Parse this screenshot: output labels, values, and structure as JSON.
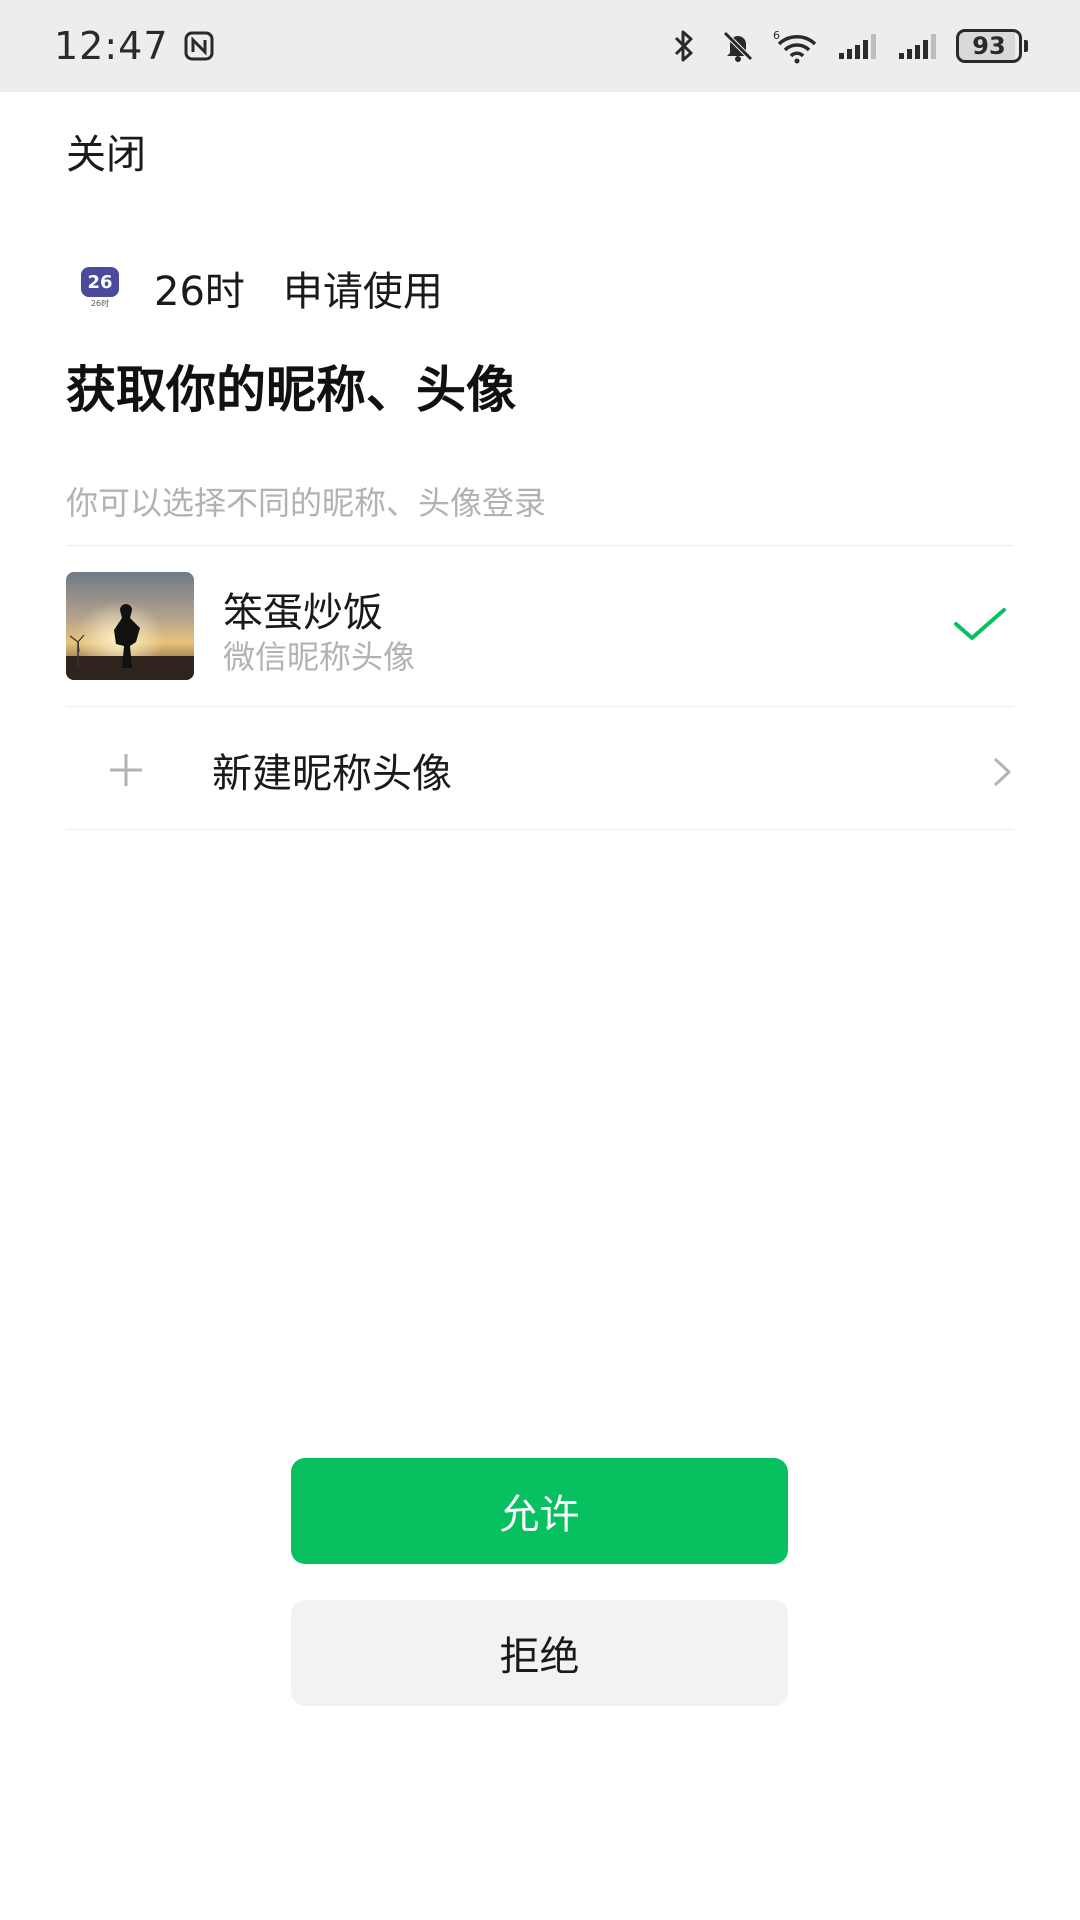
{
  "status_bar": {
    "time": "12:47",
    "battery": "93",
    "icons": [
      "nfc-icon",
      "bluetooth-icon",
      "mute-bell-icon",
      "wifi-icon",
      "signal-icon",
      "signal-icon",
      "battery-icon"
    ]
  },
  "header": {
    "close_label": "关闭"
  },
  "app": {
    "name": "26时",
    "logo_text": "26",
    "logo_caption": "26时",
    "request_text": "申请使用"
  },
  "main": {
    "title": "获取你的昵称、头像",
    "subtitle": "你可以选择不同的昵称、头像登录"
  },
  "profile": {
    "name": "笨蛋炒饭",
    "description": "微信昵称头像",
    "selected": true
  },
  "new_profile": {
    "label": "新建昵称头像"
  },
  "actions": {
    "allow_label": "允许",
    "deny_label": "拒绝"
  },
  "colors": {
    "accent": "#07c160",
    "secondary_text": "#b2b2b2",
    "status_bar_bg": "#ededed",
    "deny_bg": "#f2f2f2"
  }
}
